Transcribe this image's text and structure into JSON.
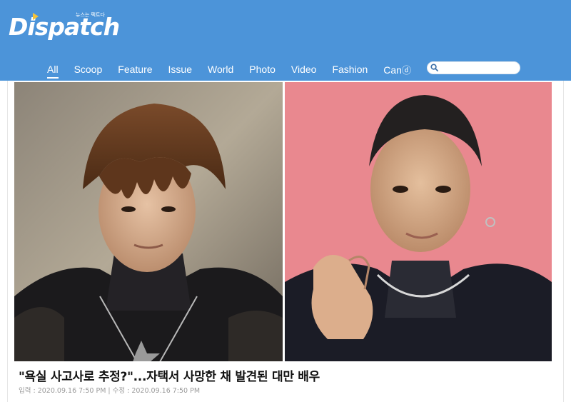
{
  "brand": {
    "name": "Dispatch",
    "tagline": "뉴스는 팩트다"
  },
  "nav": {
    "items": [
      {
        "label": "All"
      },
      {
        "label": "Scoop"
      },
      {
        "label": "Feature"
      },
      {
        "label": "Issue"
      },
      {
        "label": "World"
      },
      {
        "label": "Photo"
      },
      {
        "label": "Video"
      },
      {
        "label": "Fashion"
      }
    ],
    "can_label": "Can",
    "can_suffix": "ⓓ",
    "active": "All"
  },
  "search": {
    "placeholder": "",
    "value": "",
    "icon": "search-icon"
  },
  "article": {
    "headline": "\"욕실 사고사로 추정?\"...자택서 사망한 채 발견된 대만 배우",
    "published_label": "입력 : 2020.09.16 7:50 PM",
    "separator": "|",
    "updated_label": "수정 : 2020.09.16 7:50 PM"
  },
  "colors": {
    "header": "#4c94d9",
    "logo_accent": "#f3c23a",
    "photo_right_bg": "#e9888f"
  }
}
